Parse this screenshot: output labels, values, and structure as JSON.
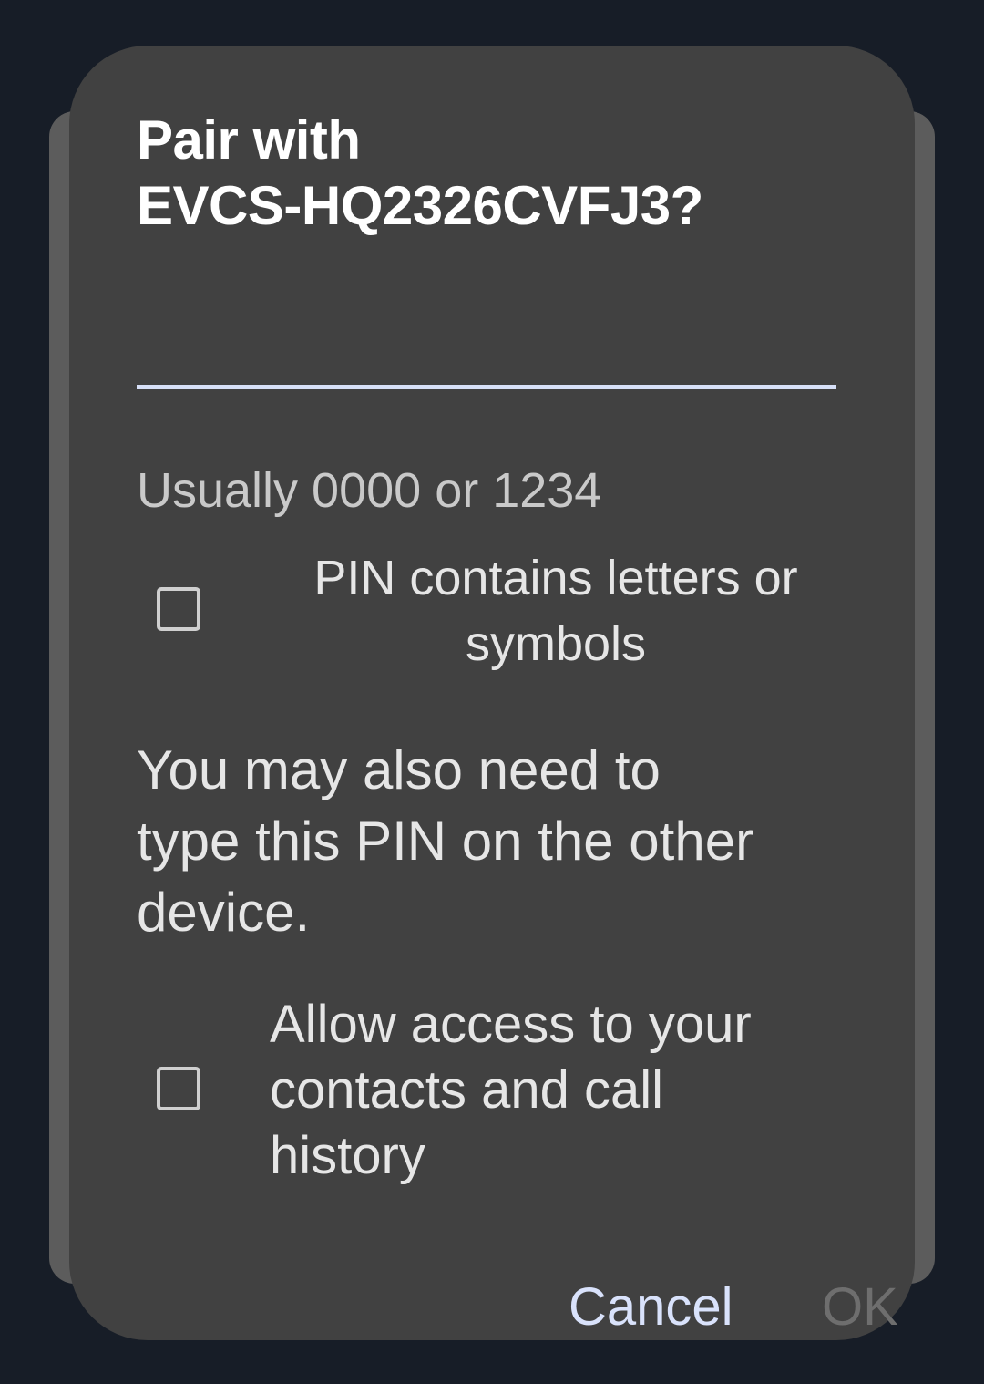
{
  "dialog": {
    "title_line1": "Pair with",
    "title_line2": "EVCS-HQ2326CVFJ3?",
    "pin_input": {
      "value": "",
      "placeholder": ""
    },
    "hint": "Usually 0000 or 1234",
    "pin_contains_letters": {
      "line1": "PIN contains letters or",
      "line2": "symbols",
      "checked": false
    },
    "note": {
      "line1": "You may also need to",
      "line2": "type this PIN on the other",
      "line3": "device."
    },
    "allow_access": {
      "line1": "Allow access to your",
      "line2": "contacts and call",
      "line3": "history",
      "checked": false
    },
    "buttons": {
      "cancel": "Cancel",
      "ok": "OK"
    }
  },
  "colors": {
    "screen_background": "#171d27",
    "dialog_background": "#414141",
    "accent": "#d9e2fb",
    "disabled_text": "#6e6e6e"
  }
}
